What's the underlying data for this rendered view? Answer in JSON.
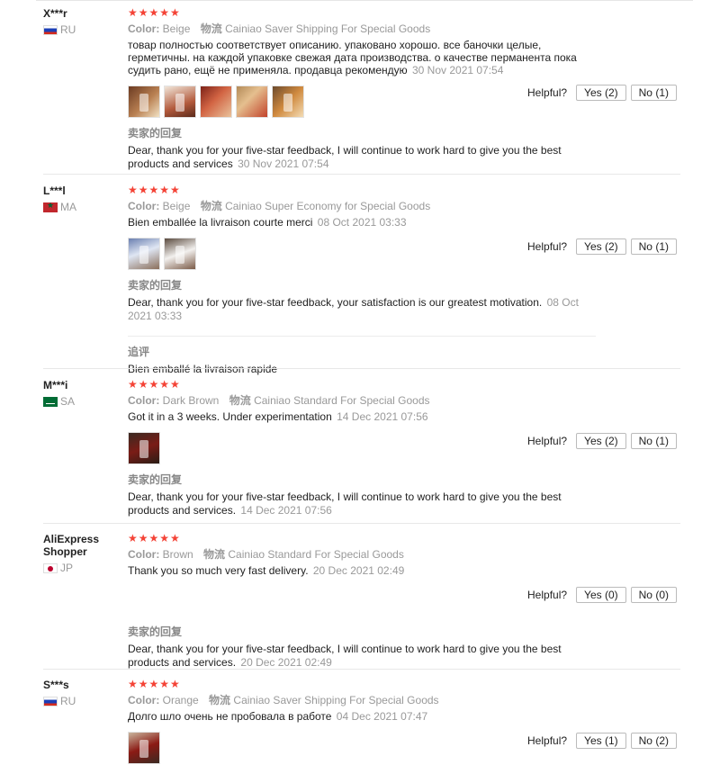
{
  "labels": {
    "color": "Color:",
    "logistics": "物流",
    "seller_reply": "卖家的回复",
    "additional_review": "追评",
    "helpful": "Helpful?",
    "yes": "Yes",
    "no": "No",
    "stars": "★★★★★"
  },
  "reviews": [
    {
      "user": "X***r",
      "country": "RU",
      "rating": 5,
      "color": "Beige",
      "shipping": "Cainiao Saver Shipping For Special Goods",
      "text": "товар полностью соответствует описанию. упаковано хорошо. все баночки целые, герметичны. на каждой упаковке свежая дата производства. о качестве перманента пока судить рано, ещё не применяла. продавца рекомендую",
      "date": "30 Nov 2021 07:54",
      "photo_count": 5,
      "seller_reply": "Dear, thank you for your five-star feedback, I will continue to work hard to give you the best products and services",
      "reply_date": "30 Nov 2021 07:54",
      "helpful_yes": "(2)",
      "helpful_no": "(1)"
    },
    {
      "user": "L***l",
      "country": "MA",
      "rating": 5,
      "color": "Beige",
      "shipping": "Cainiao Super Economy for Special Goods",
      "text": "Bien emballée la livraison courte merci",
      "date": "08 Oct 2021 03:33",
      "photo_count": 2,
      "seller_reply": "Dear, thank you for your five-star feedback, your satisfaction is our greatest motivation.",
      "reply_date": "08 Oct 2021 03:33",
      "additional_text": "Bien emballé la livraison rapide",
      "helpful_yes": "(2)",
      "helpful_no": "(1)"
    },
    {
      "user": "M***i",
      "country": "SA",
      "rating": 5,
      "color": "Dark Brown",
      "shipping": "Cainiao Standard For Special Goods",
      "text": "Got it in a 3 weeks. Under experimentation",
      "date": "14 Dec 2021 07:56",
      "photo_count": 1,
      "seller_reply": "Dear, thank you for your five-star feedback, I will continue to work hard to give you the best products and services.",
      "reply_date": "14 Dec 2021 07:56",
      "helpful_yes": "(2)",
      "helpful_no": "(1)"
    },
    {
      "user": "AliExpress Shopper",
      "country": "JP",
      "rating": 5,
      "color": "Brown",
      "shipping": "Cainiao Standard For Special Goods",
      "text": "Thank you so much very fast delivery.",
      "date": "20 Dec 2021 02:49",
      "photo_count": 0,
      "seller_reply": "Dear, thank you for your five-star feedback, I will continue to work hard to give you the best products and services.",
      "reply_date": "20 Dec 2021 02:49",
      "helpful_yes": "(0)",
      "helpful_no": "(0)"
    },
    {
      "user": "S***s",
      "country": "RU",
      "rating": 5,
      "color": "Orange",
      "shipping": "Cainiao Saver Shipping For Special Goods",
      "text": "Долго шло очень не пробовала в работе",
      "date": "04 Dec 2021 07:47",
      "photo_count": 1,
      "helpful_yes": "(1)",
      "helpful_no": "(2)"
    }
  ]
}
